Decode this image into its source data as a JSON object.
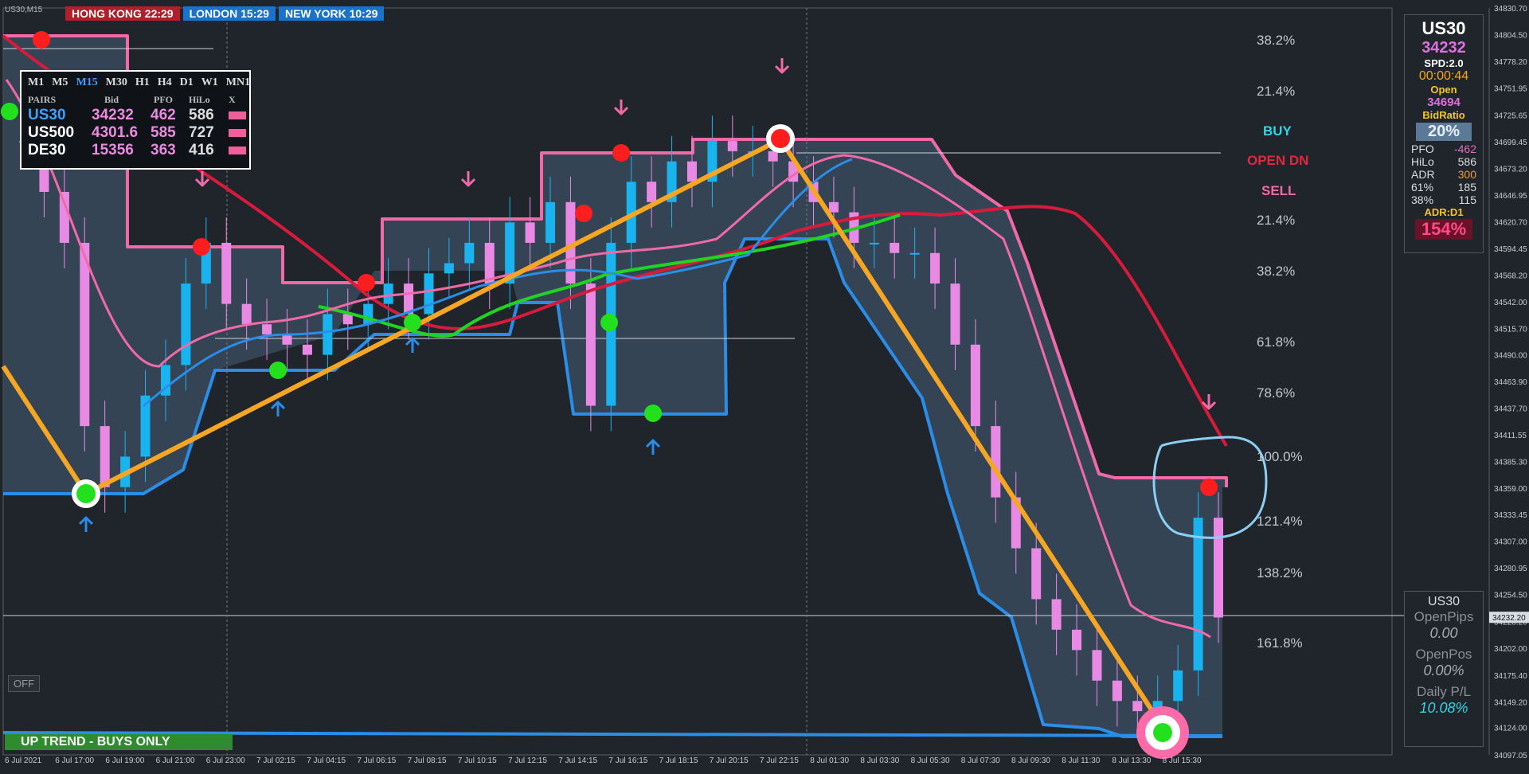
{
  "window": {
    "symbol_title": "US30,M15"
  },
  "clocks": [
    {
      "label": "HONG KONG 22:29",
      "tone": "hk"
    },
    {
      "label": "LONDON  15:29",
      "tone": "ld"
    },
    {
      "label": "NEW YORK  10:29",
      "tone": "ny"
    }
  ],
  "pairs_panel": {
    "timeframes": [
      "M1",
      "M5",
      "M15",
      "M30",
      "H1",
      "H4",
      "D1",
      "W1",
      "MN1"
    ],
    "active_timeframe": "M15",
    "headers": [
      "PAIRS",
      "Bid",
      "PFO",
      "HiLo",
      "X"
    ],
    "rows": [
      {
        "symbol": "US30",
        "bid": "34232",
        "pfo": "462",
        "hilo": "586",
        "symbol_color": "#3da0ff"
      },
      {
        "symbol": "US500",
        "bid": "4301.6",
        "pfo": "585",
        "hilo": "727",
        "symbol_color": "#ffffff"
      },
      {
        "symbol": "DE30",
        "bid": "15356",
        "pfo": "363",
        "hilo": "416",
        "symbol_color": "#ffffff"
      }
    ]
  },
  "fib_labels": [
    "38.2%",
    "21.4%",
    "21.4%",
    "38.2%",
    "61.8%",
    "78.6%",
    "100.0%",
    "121.4%",
    "138.2%",
    "161.8%"
  ],
  "signal_labels": [
    {
      "text": "BUY",
      "color": "#2fd6e8"
    },
    {
      "text": "OPEN DN",
      "color": "#e2283e"
    },
    {
      "text": "SELL",
      "color": "#f06aa8"
    }
  ],
  "info_panel": {
    "symbol": "US30",
    "price": "34232",
    "spread": "SPD:2.0",
    "timer": "00:00:44",
    "open_label": "Open",
    "open_value": "34694",
    "bid_ratio_label": "BidRatio",
    "bid_ratio_value": "20%",
    "stats": [
      {
        "k": "PFO",
        "v": "-462",
        "color": "#e070c0"
      },
      {
        "k": "HiLo",
        "v": "586",
        "color": "#dddddd"
      },
      {
        "k": "ADR",
        "v": "300",
        "color": "#f0a030"
      },
      {
        "k": "61%",
        "v": "185",
        "color": "#dddddd"
      },
      {
        "k": "38%",
        "v": "115",
        "color": "#dddddd"
      }
    ],
    "adr_label": "ADR:D1",
    "adr_value": "154%"
  },
  "positions_panel": {
    "symbol": "US30",
    "open_pips_label": "OpenPips",
    "open_pips_value": "0.00",
    "open_pos_label": "OpenPos",
    "open_pos_value": "0.00%",
    "daily_pl_label": "Daily P/L",
    "daily_pl_value": "10.08%"
  },
  "off_button": "OFF",
  "trend_banner": "UP TREND - BUYS ONLY",
  "colors": {
    "background": "#20242b",
    "bull": "#19b4f0",
    "bear": "#e88ae4",
    "band_fill": "#3a4a5c",
    "band_upper": "#f06aa8",
    "band_lower": "#2a8de8",
    "zigzag": "#f5a623",
    "ma_red": "#d81b3c",
    "ma_green": "#22d422",
    "ma_pink": "#f06aa8",
    "ma_blue": "#2a8de8"
  },
  "chart_data": {
    "type": "candlestick",
    "symbol": "US30",
    "timeframe": "M15",
    "ylim": [
      34097.05,
      34830.7
    ],
    "y_ticks": [
      "34830.70",
      "34804.50",
      "34778.20",
      "34751.95",
      "34725.65",
      "34699.45",
      "34673.20",
      "34646.95",
      "34620.70",
      "34594.45",
      "34568.20",
      "34542.00",
      "34515.70",
      "34490.00",
      "34463.90",
      "34437.70",
      "34411.55",
      "34385.30",
      "34359.00",
      "34333.45",
      "34307.00",
      "34280.95",
      "34254.50",
      "34228.20",
      "34202.00",
      "34175.40",
      "34149.20",
      "34124.00",
      "34097.05"
    ],
    "current_price": "34232.20",
    "x_labels": [
      "6 Jul 2021",
      "6 Jul 17:00",
      "6 Jul 19:00",
      "6 Jul 21:00",
      "6 Jul 23:00",
      "7 Jul 02:15",
      "7 Jul 04:15",
      "7 Jul 06:15",
      "7 Jul 08:15",
      "7 Jul 10:15",
      "7 Jul 12:15",
      "7 Jul 14:15",
      "7 Jul 16:15",
      "7 Jul 18:15",
      "7 Jul 20:15",
      "7 Jul 22:15",
      "8 Jul 01:30",
      "8 Jul 03:30",
      "8 Jul 05:30",
      "8 Jul 07:30",
      "8 Jul 09:30",
      "8 Jul 11:30",
      "8 Jul 13:30",
      "8 Jul 15:30"
    ],
    "close_path": [
      34700,
      34650,
      34600,
      34420,
      34360,
      34390,
      34450,
      34480,
      34560,
      34600,
      34540,
      34520,
      34510,
      34500,
      34490,
      34530,
      34520,
      34540,
      34560,
      34530,
      34570,
      34580,
      34600,
      34560,
      34620,
      34600,
      34640,
      34560,
      34440,
      34600,
      34660,
      34640,
      34680,
      34660,
      34700,
      34690,
      34690,
      34680,
      34660,
      34640,
      34630,
      34600,
      34600,
      34590,
      34590,
      34560,
      34500,
      34420,
      34350,
      34300,
      34250,
      34220,
      34200,
      34170,
      34150,
      34140,
      34150,
      34180,
      34330,
      34232
    ]
  }
}
